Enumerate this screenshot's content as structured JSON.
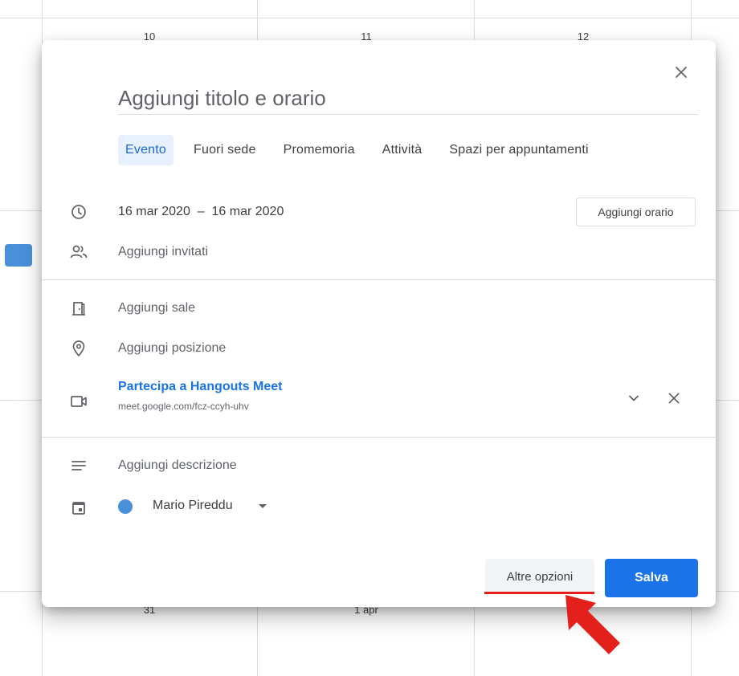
{
  "calendar": {
    "day_numbers": [
      "10",
      "11",
      "12"
    ],
    "bottom_labels": [
      "31",
      "1 apr"
    ],
    "event_color": "#4a90d9"
  },
  "dialog": {
    "title_placeholder": "Aggiungi titolo e orario",
    "tabs": [
      {
        "label": "Evento",
        "active": true
      },
      {
        "label": "Fuori sede",
        "active": false
      },
      {
        "label": "Promemoria",
        "active": false
      },
      {
        "label": "Attività",
        "active": false
      },
      {
        "label": "Spazi per appuntamenti",
        "active": false
      }
    ],
    "date_range": "16 mar 2020  –  16 mar 2020",
    "add_time_label": "Aggiungi orario",
    "add_guests_label": "Aggiungi invitati",
    "add_rooms_label": "Aggiungi sale",
    "add_location_label": "Aggiungi posizione",
    "meet": {
      "title": "Partecipa a Hangouts Meet",
      "url": "meet.google.com/fcz-ccyh-uhv"
    },
    "add_description_label": "Aggiungi descrizione",
    "calendar_owner": "Mario Pireddu",
    "calendar_color": "#4a90d9",
    "more_options_label": "Altre opzioni",
    "save_label": "Salva"
  },
  "colors": {
    "accent": "#1a73e8",
    "annotation_red": "#e3201b"
  },
  "icons": [
    "close-icon",
    "clock-icon",
    "people-icon",
    "door-icon",
    "location-pin-icon",
    "video-camera-icon",
    "chevron-down-icon",
    "description-lines-icon",
    "calendar-icon",
    "red-arrow-icon"
  ]
}
